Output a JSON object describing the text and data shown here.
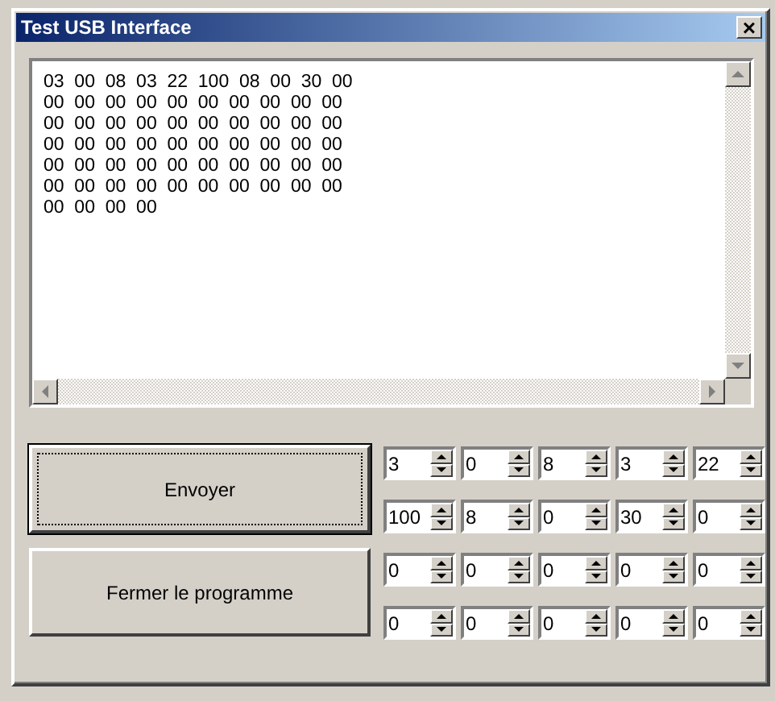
{
  "window": {
    "title": "Test USB Interface",
    "close_symbol": "×"
  },
  "output": {
    "lines": [
      "03  00  08  03  22  100  08  00  30  00",
      "00  00  00  00  00  00  00  00  00  00",
      "00  00  00  00  00  00  00  00  00  00",
      "00  00  00  00  00  00  00  00  00  00",
      "00  00  00  00  00  00  00  00  00  00",
      "00  00  00  00  00  00  00  00  00  00",
      "00  00  00  00"
    ]
  },
  "buttons": [
    {
      "label": "Envoyer",
      "focused": true
    },
    {
      "label": "Fermer le programme",
      "focused": false
    }
  ],
  "spinners": [
    [
      "3",
      "0",
      "8",
      "3",
      "22"
    ],
    [
      "100",
      "8",
      "0",
      "30",
      "0"
    ],
    [
      "0",
      "0",
      "0",
      "0",
      "0"
    ],
    [
      "0",
      "0",
      "0",
      "0",
      "0"
    ]
  ]
}
